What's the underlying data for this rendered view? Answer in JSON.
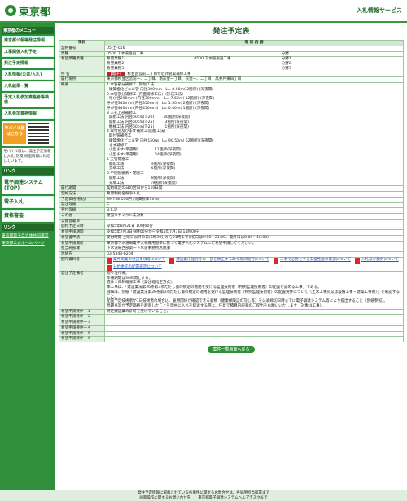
{
  "header": {
    "logo": "東京都",
    "site": "入札情報サービス"
  },
  "sidebar": {
    "section_top": "東京都のメニュー",
    "items": [
      "東京都公報等発注情報",
      "工事関係入札予定",
      "発注予定情報",
      "入札情報(公表/入札)",
      "入札結果一覧",
      "予定入札参加資格者等検索",
      "入札参加資格情報"
    ],
    "mobile_label": "モバイル版はこちら",
    "mobile_note": "モバイル版は、発注予定情報と入札(見積)経過情報に対応しています。",
    "section2": "リンク",
    "big1": "電子調達システム(TOP)",
    "big2": "電子入札",
    "big3": "資格審査",
    "section3": "リンク",
    "links": [
      "東京都電子自治体共同運営",
      "東京都公式ホームページ"
    ]
  },
  "page": {
    "title": "発注予定表",
    "col_item": "項目",
    "col_content": "項 目 内 容"
  },
  "rows": {
    "contract_no": {
      "label": "契約番号",
      "value": "05-土-016"
    },
    "type": {
      "label": "業種",
      "value": "0500 下水道施設工事",
      "s1": "分野",
      "s1v": ""
    },
    "hopes": {
      "label": "希望業種業種",
      "r1a": "希望業種1",
      "r1b": "0500 下水道施設工事",
      "r1c": "分野1",
      "r2a": "希望業種2",
      "r2b": "",
      "r2c": "分野2",
      "r3a": "希望業種3",
      "r3b": "",
      "r3c": "分野3"
    },
    "subject": {
      "label": "件 名",
      "tag": "【電子】",
      "value": "杉並区宮前二丁目付近外管渠補修工事"
    },
    "place": {
      "label": "履行場所",
      "value": "東京都杉並区宮前一、二丁目、南荻窪一丁目、荻窪一、二丁目、高井戸東四丁目"
    },
    "summary": {
      "label": "概要",
      "value": "1 本管部分補修工 (開削工法)\n  硬質塩化ビニル管 内径300mm   L= 8.00m( 2箇所) (深夜間)\n2 本管部分補修工 (内面補修工法)  (形成工法)\n  呼び径290mm (内径300mm)   L= 7.60m( 12箇所) (深夜間)\n呼び径340mm (内径350mm)   L= 1.50m( 2箇所) (深夜間)\n呼び径440mm (内径450mm)   L= 0.40m( 1箇所) (深夜間)\n3 人孔上部補修工\n  開削工法 内径60cm(T-20)        30箇所(深夜間)\n  開削工法 内径60cm(T-25)         3箇所(深夜間)\n  機械工法 内径60cm(T-25)         1箇所(深夜間)\n4 取付管及びます補修工(開削工法)\n  取付管補修工\n  硬質塩化ビニル管 内径150㎜   L= 90.50m( 62箇所)(深夜間)\n  ます補修工\n  小型ます(単週用)              11箇所(深夜間)\n  小型ます(単週用)              54箇所(深夜間)\n5 支管閉塞工\n  開削工法                       9箇所(深夜間)\n  充填工法                       5箇所(深夜間)\n6 不明管撤去・閉塞工\n  開削工法                       8箇所(深夜間)\n  充填工法                      19箇所(深夜間)"
    },
    "period": {
      "label": "履行期間",
      "value": "契約確定の日の翌日から110日間"
    },
    "method": {
      "label": "契約方法",
      "value": "希望制指名競争入札"
    },
    "price": {
      "label": "予定価格(税込)",
      "value": "89,738,100円 (消費税率10%)"
    },
    "ordertype": {
      "label": "発注等級",
      "value": "C"
    },
    "rank": {
      "label": "受付等級",
      "value": "B,C,D"
    },
    "other": {
      "label": "その他",
      "value": "建設リサイクル法対象"
    },
    "co": {
      "label": "公開登載日",
      "value": ""
    },
    "reg_date": {
      "label": "開札予定日時",
      "value": "令和5年8月21日 10時00分"
    },
    "apply_period": {
      "label": "希望申請期間",
      "value": "令和5年7月3日 9時00分から令和5年7月7日 15時00分"
    },
    "apply_method": {
      "label": "希望書申請",
      "value": "受付時間 土曜日以外の日(8時30分から21時まで)(初日は9:00〜21:00、最終日は8:00〜15:00)"
    },
    "apply_place": {
      "label": "希望申請場所",
      "value": "東京都下水道局電子入札運用基準に基づく電子入札システムにて希望申請してください。"
    },
    "office": {
      "label": "担当局部課",
      "value": "下水道局西部第一下水道事務所庶務課"
    },
    "tel": {
      "label": "連絡先",
      "value": "03-5343-6204"
    },
    "docs": {
      "label": "配布資料等",
      "items": [
        "案件掲載の付記事項等について",
        "建設業法施行令の一部を改正する政令等の施行について",
        "工事で必要とする安全性能の確認について",
        "入札及び契約について",
        "分析委託の配置選定について"
      ]
    },
    "notes": {
      "label": "発注予定備考",
      "value": "適り注付要。\n準備期間は30日間とする。\n週休２日制確保工事（発注者指定方式）。\n本工事は、「建設業法第26条第3項ただし書の規定の適用を受ける監理技術者（特例監理技術者）の配置を認める工事」である。\n詳細は、別紙「建設業法第26条第3項ただし書の規定の適用を受ける監理技術者（特例監理技術者）の配置要件について（土木工事同又は設備工事・建築工事用）」を確認すること。\n配置予定技術者が1日技術者の場合は、雇用関係が確認できる書類（健康保険証の写し等）を公表締切日時までに電子調達システム等により提出すること（別紙参照）。\n問題点等が予定価格を超過したことを理由に入札を辞退する際に、任意で積算内訳書のご提出をお願いいたします（対象は工事）。"
    },
    "req1": {
      "label": "希望申請要件一１",
      "value": "特定建設業の許可を受けていること。"
    },
    "req2": {
      "label": "希望申請要件一２",
      "value": ""
    },
    "req3": {
      "label": "希望申請要件一３",
      "value": ""
    },
    "req4": {
      "label": "希望申請要件一４",
      "value": ""
    },
    "req5": {
      "label": "希望申請要件一５",
      "value": ""
    },
    "req6": {
      "label": "希望申請要件一６",
      "value": ""
    }
  },
  "back_button": "案件一覧画面へ戻る",
  "footer": {
    "line1": "発注予定情報に掲載されている各事件に関するお問合せは、各局所担当部署まで",
    "line2": "画面操作に関するお問い合せ先　　東京都電子調達システムヘルプデスクまで"
  }
}
